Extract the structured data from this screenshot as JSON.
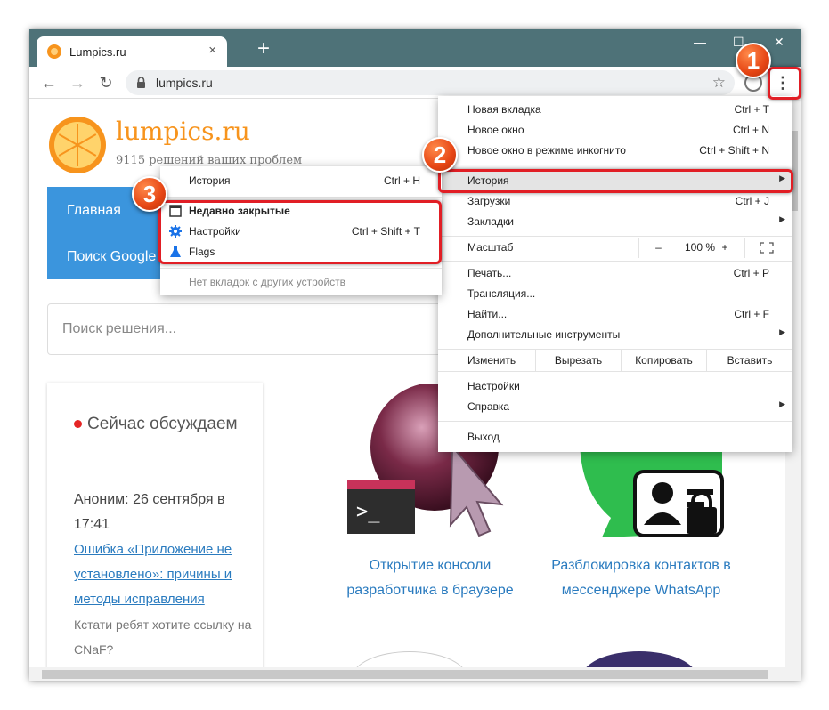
{
  "browser": {
    "tab_title": "Lumpics.ru",
    "tab_close": "×",
    "new_tab": "+",
    "url": "lumpics.ru",
    "window_controls": {
      "minimize": "—",
      "maximize": "☐",
      "close": "✕"
    }
  },
  "site": {
    "brand": "lumpics.ru",
    "tagline": "9115 решений ваших проблем",
    "nav": {
      "home": "Главная",
      "search_google": "Поиск Google"
    },
    "search_placeholder": "Поиск решения...",
    "discussion": {
      "title": "Сейчас обсуждаем",
      "author_line": "Аноним: 26 сентября в 17:41",
      "link": "Ошибка «Приложение не установлено»: причины и методы исправления",
      "comment": "Кстати ребят хотите ссылку на CNaF?"
    },
    "articles": [
      {
        "title": "Открытие консоли разработчика в браузере"
      },
      {
        "title": "Разблокировка контактов в мессенджере WhatsApp"
      }
    ]
  },
  "menu": {
    "new_tab": {
      "label": "Новая вкладка",
      "shortcut": "Ctrl + T"
    },
    "new_window": {
      "label": "Новое окно",
      "shortcut": "Ctrl + N"
    },
    "incognito": {
      "label": "Новое окно в режиме инкогнито",
      "shortcut": "Ctrl + Shift + N"
    },
    "history": {
      "label": "История"
    },
    "downloads": {
      "label": "Загрузки",
      "shortcut": "Ctrl + J"
    },
    "bookmarks": {
      "label": "Закладки"
    },
    "zoom": {
      "label": "Масштаб",
      "minus": "–",
      "value": "100 %",
      "plus": "+"
    },
    "print": {
      "label": "Печать...",
      "shortcut": "Ctrl + P"
    },
    "cast": {
      "label": "Трансляция..."
    },
    "find": {
      "label": "Найти...",
      "shortcut": "Ctrl + F"
    },
    "more_tools": {
      "label": "Дополнительные инструменты"
    },
    "edit": {
      "label": "Изменить",
      "cut": "Вырезать",
      "copy": "Копировать",
      "paste": "Вставить"
    },
    "settings": {
      "label": "Настройки"
    },
    "help": {
      "label": "Справка"
    },
    "exit": {
      "label": "Выход"
    }
  },
  "history_submenu": {
    "history": {
      "label": "История",
      "shortcut": "Ctrl + H"
    },
    "recently_closed": {
      "label": "Недавно закрытые"
    },
    "settings": {
      "label": "Настройки",
      "shortcut": "Ctrl + Shift + T"
    },
    "flags": {
      "label": "Flags"
    },
    "no_tabs": {
      "label": "Нет вкладок с других устройств"
    }
  },
  "badges": {
    "one": "1",
    "two": "2",
    "three": "3"
  },
  "colors": {
    "titlebar": "#4e7278",
    "accent": "#f7941d",
    "nav_blue": "#3b95dd",
    "highlight_red": "#e11e25"
  }
}
